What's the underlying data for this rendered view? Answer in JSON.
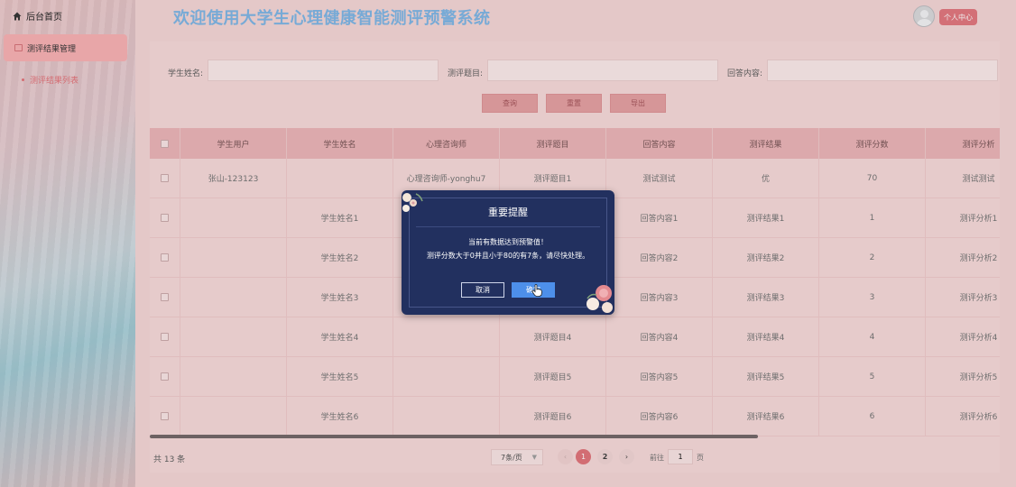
{
  "sidebar": {
    "home": "后台首页",
    "group": "测评结果管理",
    "sub": "测评结果列表"
  },
  "header": {
    "title": "欢迎使用大学生心理健康智能测评预警系统",
    "user_center": "个人中心"
  },
  "search": {
    "student_name_label": "学生姓名:",
    "question_label": "测评题目:",
    "answer_label": "回答内容:",
    "query_button": "查询",
    "reset_button": "重置",
    "export_button": "导出"
  },
  "table": {
    "columns": [
      "学生用户",
      "学生姓名",
      "心理咨询师",
      "测评题目",
      "回答内容",
      "测评结果",
      "测评分数",
      "测评分析"
    ],
    "rows": [
      [
        "张山-123123",
        "",
        "心理咨询师-yonghu7",
        "测评题目1",
        "测试测试",
        "优",
        "70",
        "测试测试"
      ],
      [
        "",
        "学生姓名1",
        "",
        "",
        "回答内容1",
        "测评结果1",
        "1",
        "测评分析1"
      ],
      [
        "",
        "学生姓名2",
        "",
        "",
        "回答内容2",
        "测评结果2",
        "2",
        "测评分析2"
      ],
      [
        "",
        "学生姓名3",
        "",
        "",
        "回答内容3",
        "测评结果3",
        "3",
        "测评分析3"
      ],
      [
        "",
        "学生姓名4",
        "",
        "测评题目4",
        "回答内容4",
        "测评结果4",
        "4",
        "测评分析4"
      ],
      [
        "",
        "学生姓名5",
        "",
        "测评题目5",
        "回答内容5",
        "测评结果5",
        "5",
        "测评分析5"
      ],
      [
        "",
        "学生姓名6",
        "",
        "测评题目6",
        "回答内容6",
        "测评结果6",
        "6",
        "测评分析6"
      ]
    ]
  },
  "pagination": {
    "total": "共 13 条",
    "page_size": "7条/页",
    "prev": "‹",
    "page1": "1",
    "page2": "2",
    "next": "›",
    "goto_label": "前往",
    "goto_value": "1",
    "goto_suffix": "页"
  },
  "modal": {
    "title": "重要提醒",
    "message_line1": "当前有数据达到预警值！",
    "message_line2": "测评分数大于0并且小于80的有7条，请尽快处理。",
    "cancel": "取消",
    "ok": "确定"
  },
  "colors": {
    "accent": "#df6c72",
    "title_blue": "#77b1e3",
    "modal_bg": "#22305f",
    "ok_button": "#4d8fea"
  }
}
